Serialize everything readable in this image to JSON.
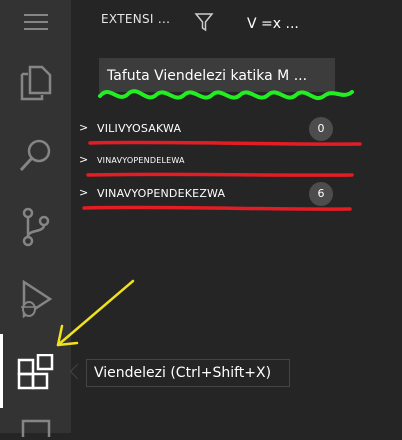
{
  "activity_bar": {
    "items": [
      {
        "name": "menu"
      },
      {
        "name": "explorer"
      },
      {
        "name": "search"
      },
      {
        "name": "source-control"
      },
      {
        "name": "run-debug"
      },
      {
        "name": "extensions"
      }
    ]
  },
  "sidebar": {
    "title": "EXTENSI ...",
    "sort_label": "V =x ...",
    "search_value": "Tafuta Viendelezi katika M ...",
    "sections": [
      {
        "label": "VILIVYOSAKWA",
        "count": "0",
        "chevron": ">"
      },
      {
        "label": "VINAVYOPENDELEWA",
        "chevron": ">"
      },
      {
        "label": "VINAVYOPENDEKEZWA",
        "count": "6",
        "chevron": ">"
      }
    ]
  },
  "tooltip": {
    "text": "Viendelezi (Ctrl+Shift+X)"
  },
  "annotations": {
    "colors": {
      "red_underline": "#e51c23",
      "green_scribble": "#22ee22",
      "yellow_arrow": "#f2e21c"
    }
  }
}
